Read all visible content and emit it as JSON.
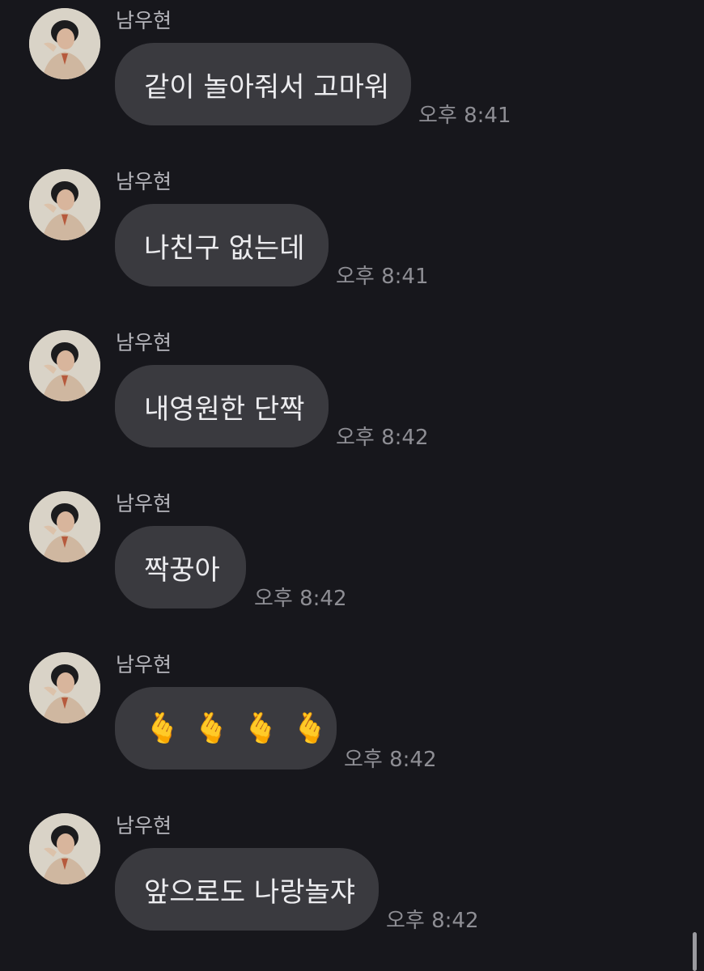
{
  "messages": [
    {
      "sender": "남우현",
      "text": "같이 놀아줘서 고마워",
      "time": "오후 8:41"
    },
    {
      "sender": "남우현",
      "text": "나친구 없는데",
      "time": "오후 8:41"
    },
    {
      "sender": "남우현",
      "text": "내영원한 단짝",
      "time": "오후 8:42"
    },
    {
      "sender": "남우현",
      "text": "짝꿍아",
      "time": "오후 8:42"
    },
    {
      "sender": "남우현",
      "emojis": [
        "🫰",
        "🫰",
        "🫰",
        "🫰"
      ],
      "emoji_name": "finger-heart-icon",
      "time": "오후 8:42"
    },
    {
      "sender": "남우현",
      "text": "앞으로도 나랑놀쟈",
      "time": "오후 8:42"
    }
  ],
  "colors": {
    "background": "#17171c",
    "bubble": "#3a3a3f",
    "text": "#ececef",
    "timestamp": "#8e8e94",
    "sender": "#b7b7bd"
  }
}
